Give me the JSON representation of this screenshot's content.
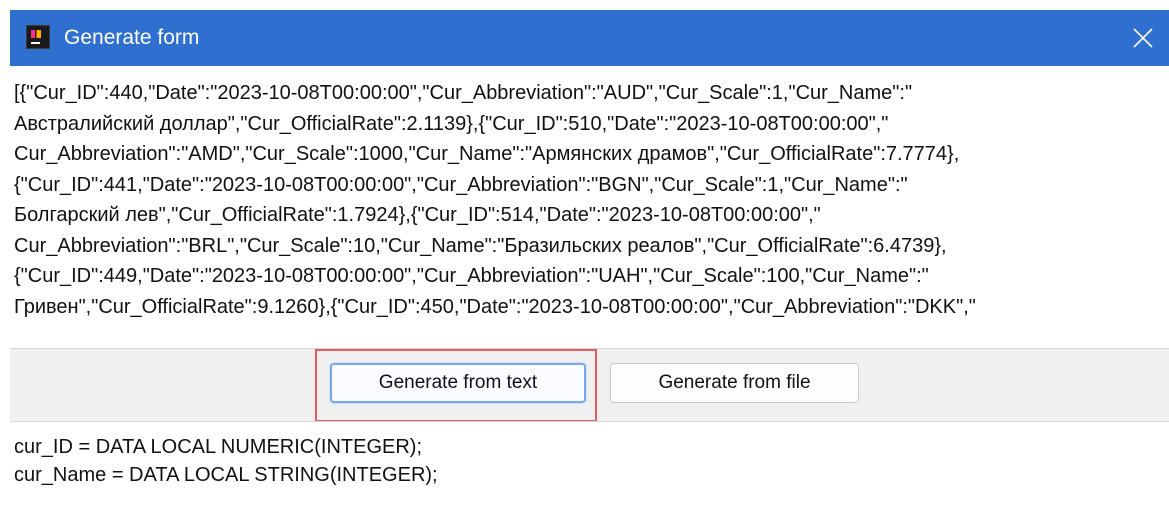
{
  "window": {
    "title": "Generate form",
    "app_icon": "intellij-app-icon",
    "close_icon": "close-icon",
    "titlebar_color": "#2f6fd0"
  },
  "input_text": "[{\"Cur_ID\":440,\"Date\":\"2023-10-08T00:00:00\",\"Cur_Abbreviation\":\"AUD\",\"Cur_Scale\":1,\"Cur_Name\":\"\nАвстралийский доллар\",\"Cur_OfficialRate\":2.1139},{\"Cur_ID\":510,\"Date\":\"2023-10-08T00:00:00\",\"\nCur_Abbreviation\":\"AMD\",\"Cur_Scale\":1000,\"Cur_Name\":\"Армянских драмов\",\"Cur_OfficialRate\":7.7774},\n{\"Cur_ID\":441,\"Date\":\"2023-10-08T00:00:00\",\"Cur_Abbreviation\":\"BGN\",\"Cur_Scale\":1,\"Cur_Name\":\"\nБолгарский лев\",\"Cur_OfficialRate\":1.7924},{\"Cur_ID\":514,\"Date\":\"2023-10-08T00:00:00\",\"\nCur_Abbreviation\":\"BRL\",\"Cur_Scale\":10,\"Cur_Name\":\"Бразильских реалов\",\"Cur_OfficialRate\":6.4739},\n{\"Cur_ID\":449,\"Date\":\"2023-10-08T00:00:00\",\"Cur_Abbreviation\":\"UAH\",\"Cur_Scale\":100,\"Cur_Name\":\"\nГривен\",\"Cur_OfficialRate\":9.1260},{\"Cur_ID\":450,\"Date\":\"2023-10-08T00:00:00\",\"Cur_Abbreviation\":\"DKK\",\"",
  "buttons": {
    "generate_from_text": "Generate from text",
    "generate_from_file": "Generate from file",
    "highlight_color": "#e55b61"
  },
  "output_lines": [
    "cur_ID = DATA LOCAL NUMERIC(INTEGER);",
    "cur_Name = DATA LOCAL STRING(INTEGER);"
  ]
}
